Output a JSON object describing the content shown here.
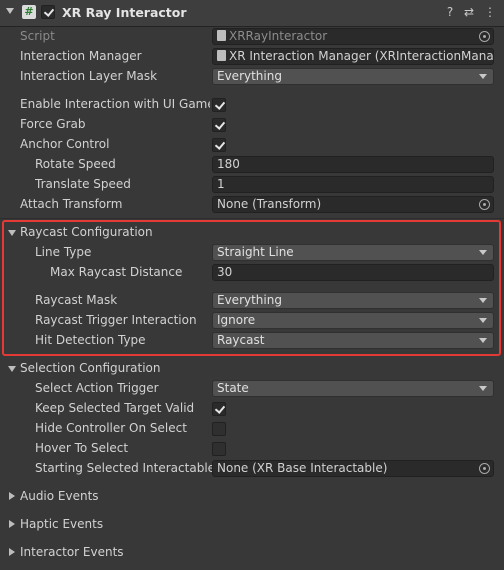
{
  "header": {
    "title": "XR Ray Interactor",
    "icon_text": "#"
  },
  "script": {
    "label": "Script",
    "value": "XRRayInteractor"
  },
  "interaction_manager": {
    "label": "Interaction Manager",
    "value": "XR Interaction Manager (XRInteractionManager)"
  },
  "interaction_layer_mask": {
    "label": "Interaction Layer Mask",
    "value": "Everything"
  },
  "enable_ui": {
    "label": "Enable Interaction with UI GameObjects",
    "checked": true
  },
  "force_grab": {
    "label": "Force Grab",
    "checked": true
  },
  "anchor_control": {
    "label": "Anchor Control",
    "checked": true
  },
  "rotate_speed": {
    "label": "Rotate Speed",
    "value": "180"
  },
  "translate_speed": {
    "label": "Translate Speed",
    "value": "1"
  },
  "attach_transform": {
    "label": "Attach Transform",
    "value": "None (Transform)"
  },
  "raycast": {
    "title": "Raycast Configuration",
    "line_type": {
      "label": "Line Type",
      "value": "Straight Line"
    },
    "max_distance": {
      "label": "Max Raycast Distance",
      "value": "30"
    },
    "raycast_mask": {
      "label": "Raycast Mask",
      "value": "Everything"
    },
    "trigger_interaction": {
      "label": "Raycast Trigger Interaction",
      "value": "Ignore"
    },
    "hit_detection": {
      "label": "Hit Detection Type",
      "value": "Raycast"
    }
  },
  "selection": {
    "title": "Selection Configuration",
    "select_action_trigger": {
      "label": "Select Action Trigger",
      "value": "State"
    },
    "keep_selected": {
      "label": "Keep Selected Target Valid",
      "checked": true
    },
    "hide_controller": {
      "label": "Hide Controller On Select",
      "checked": false
    },
    "hover_to_select": {
      "label": "Hover To Select",
      "checked": false
    },
    "starting_selected": {
      "label": "Starting Selected Interactable",
      "value": "None (XR Base Interactable)"
    }
  },
  "foldouts": {
    "audio": "Audio Events",
    "haptic": "Haptic Events",
    "interactor": "Interactor Events"
  }
}
